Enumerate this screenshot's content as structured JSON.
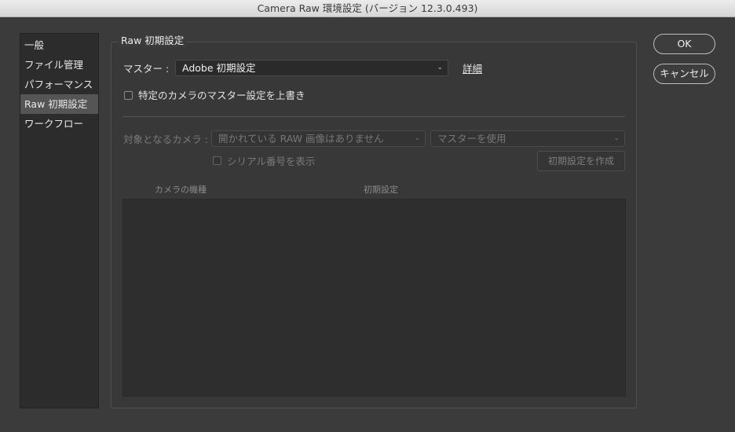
{
  "window": {
    "title": "Camera Raw 環境設定 (バージョン 12.3.0.493)"
  },
  "sidebar": {
    "items": [
      {
        "label": "一般"
      },
      {
        "label": "ファイル管理"
      },
      {
        "label": "パフォーマンス"
      },
      {
        "label": "Raw 初期設定"
      },
      {
        "label": "ワークフロー"
      }
    ],
    "selected": "Raw 初期設定"
  },
  "raw_defaults": {
    "group_title": "Raw 初期設定",
    "master_label": "マスター :",
    "master_value": "Adobe 初期設定",
    "details_link": "詳細",
    "override_checkbox_label": "特定のカメラのマスター設定を上書き",
    "override_checked": false,
    "target_camera_label": "対象となるカメラ :",
    "camera_select_value": "開かれている RAW 画像はありません",
    "defaults_select_value": "マスターを使用",
    "serial_checkbox_label": "シリアル番号を表示",
    "serial_checked": false,
    "create_defaults_button": "初期設定を作成",
    "table": {
      "columns": [
        "カメラの機種",
        "初期設定"
      ],
      "rows": []
    }
  },
  "buttons": {
    "ok": "OK",
    "cancel": "キャンセル"
  },
  "icons": {
    "dropdown": "chevron-down-icon",
    "checkbox": "checkbox-icon"
  }
}
